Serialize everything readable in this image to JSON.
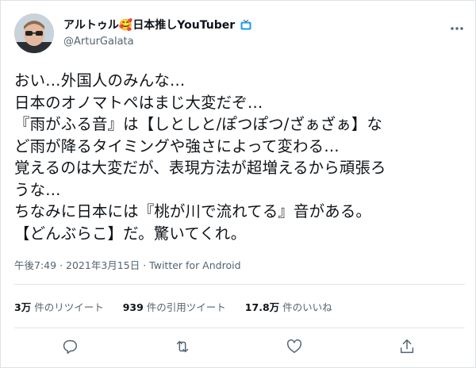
{
  "tweet": {
    "display_name": "アルトゥル",
    "display_name_emoji": "🥰",
    "display_name_suffix": "日本推しYouTuber",
    "handle": "@ArturGalata",
    "text_lines": [
      "おい…外国人のみんな…",
      "日本のオノマトペはまじ大変だぞ…",
      "『雨がふる音』は【しとしと/ぽつぽつ/ざぁざぁ】な",
      "ど雨が降るタイミングや強さによって変わる…",
      "覚えるのは大変だが、表現方法が超増えるから頑張ろ",
      "うな…",
      "ちなみに日本には『桃が川で流れてる』音がある。",
      "【どんぶらこ】だ。驚いてくれ。"
    ],
    "time": "午後7:49",
    "date": "2021年3月15日",
    "separator": "·",
    "source": "Twitter for Android"
  },
  "stats": {
    "retweets": {
      "count": "3万",
      "label": "件のリツイート"
    },
    "quotes": {
      "count": "939",
      "label": "件の引用ツイート"
    },
    "likes": {
      "count": "17.8万",
      "label": "件のいいね"
    }
  },
  "icons": {
    "more": "more-icon",
    "reply": "reply-icon",
    "retweet": "retweet-icon",
    "like": "heart-icon",
    "share": "share-icon",
    "tv": "tv-icon"
  },
  "colors": {
    "text": "#0f1419",
    "secondary": "#536471",
    "tv_icon": "#1d9bf0",
    "divider": "#e1e6ea"
  }
}
